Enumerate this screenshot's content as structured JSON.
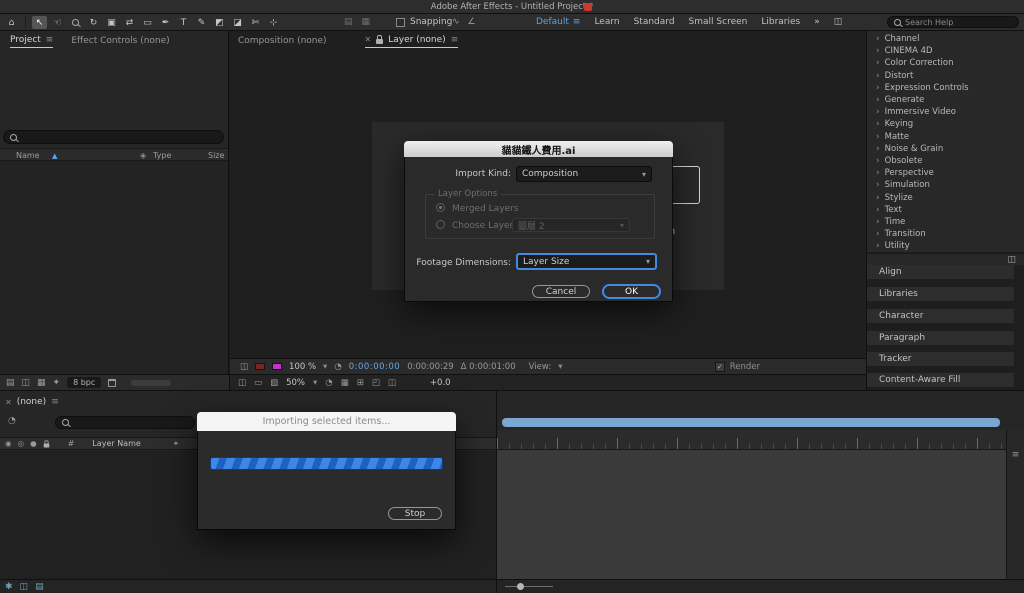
{
  "titlebar": {
    "title": "Adobe After Effects - Untitled Project *"
  },
  "toolbar": {
    "snapping_label": "Snapping",
    "workspaces": [
      "Default",
      "Learn",
      "Standard",
      "Small Screen",
      "Libraries"
    ],
    "overflow": "»",
    "search_placeholder": "Search Help"
  },
  "icons": {
    "menu": "≡",
    "hamburger": "≡",
    "close": "✕",
    "chevron_down": "▾",
    "chevron_right": "›",
    "check": "✓",
    "sort_asc": "▲",
    "person": "☻",
    "clock": "◔",
    "home": "⌂",
    "selection": "↖",
    "hand": "☜",
    "orbit": "↻",
    "camera": "▣",
    "pan_behind": "⇄",
    "shape": "▭",
    "pen": "✒",
    "type": "T",
    "brush": "✎",
    "clone_stamp": "◩",
    "eraser": "◪",
    "roto_brush": "✄",
    "puppet": "⊹",
    "panel": "◫",
    "grid": "▦",
    "proxy": "▤",
    "hatch": "▧",
    "wave": "∿",
    "angle": "∠",
    "eye": "◉",
    "audio": "◎",
    "solo": "●",
    "star": "✦",
    "gear": "✱",
    "effects": "◈",
    "box": "◰",
    "plus_grid": "⊞"
  },
  "left_panel": {
    "tabs": [
      "Project",
      "Effect Controls (none)"
    ],
    "columns": {
      "name": "Name",
      "type": "Type",
      "size": "Size"
    },
    "bpc_label": "8 bpc"
  },
  "viewer": {
    "tab_composition": "Composition (none)",
    "tab_layer": "Layer (none)",
    "magnification": "100 %",
    "current_time": "0:00:00:00",
    "out_point": "0:00:00:29",
    "duration": "Δ 0:00:01:00",
    "view_label": "View:",
    "render_label": "Render",
    "magnification2": "50%",
    "exposure": "+0.0",
    "hint_fragments": [
      "ion",
      "e"
    ]
  },
  "effects_panel": {
    "categories": [
      "Channel",
      "CINEMA 4D",
      "Color Correction",
      "Distort",
      "Expression Controls",
      "Generate",
      "Immersive Video",
      "Keying",
      "Matte",
      "Noise & Grain",
      "Obsolete",
      "Perspective",
      "Simulation",
      "Stylize",
      "Text",
      "Time",
      "Transition",
      "Utility"
    ]
  },
  "side_panels": {
    "items": [
      "Align",
      "Libraries",
      "Character",
      "Paragraph",
      "Tracker",
      "Content-Aware Fill"
    ]
  },
  "timeline_panel": {
    "tab": "(none)",
    "hash_column": "#",
    "layer_name_column": "Layer Name"
  },
  "import_dialog": {
    "title": "貓貓鐵人費用.ai",
    "import_kind_label": "Import Kind:",
    "import_kind_value": "Composition",
    "layer_options_label": "Layer Options",
    "merged_layers_label": "Merged Layers",
    "choose_layer_label": "Choose Layer:",
    "choose_layer_value": "圖層 2",
    "footage_dimensions_label": "Footage Dimensions:",
    "footage_dimensions_value": "Layer Size",
    "cancel_label": "Cancel",
    "ok_label": "OK"
  },
  "progress_dialog": {
    "message": "Importing selected items...",
    "stop_label": "Stop"
  },
  "colors": {
    "accent_blue": "#3f8ae2",
    "workspace_active_blue": "#5aa2e8",
    "timecode_blue": "#62a8e8",
    "progress_blue": "#2f7de1",
    "dialog_title_gray": "#e0e0e0"
  }
}
